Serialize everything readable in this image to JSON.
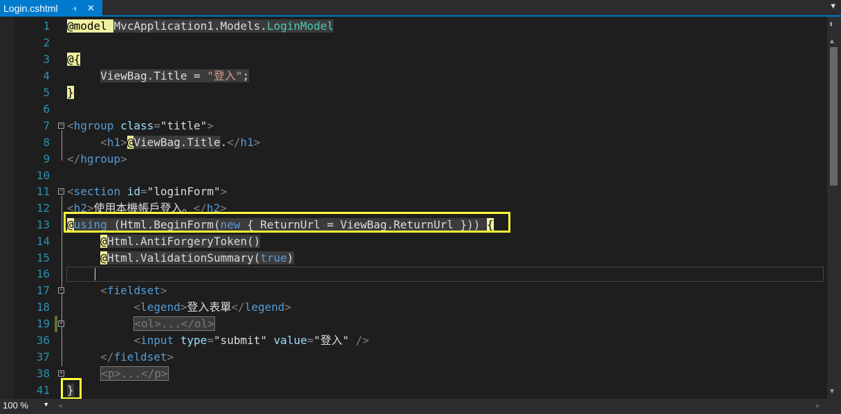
{
  "tab": {
    "title": "Login.cshtml",
    "pin_icon": "pin-icon",
    "close_icon": "close-icon"
  },
  "lines": [
    {
      "n": "1"
    },
    {
      "n": "2"
    },
    {
      "n": "3"
    },
    {
      "n": "4"
    },
    {
      "n": "5"
    },
    {
      "n": "6"
    },
    {
      "n": "7"
    },
    {
      "n": "8"
    },
    {
      "n": "9"
    },
    {
      "n": "10"
    },
    {
      "n": "11"
    },
    {
      "n": "12"
    },
    {
      "n": "13"
    },
    {
      "n": "14"
    },
    {
      "n": "15"
    },
    {
      "n": "16"
    },
    {
      "n": "17"
    },
    {
      "n": "18"
    },
    {
      "n": "19"
    },
    {
      "n": "36"
    },
    {
      "n": "37"
    },
    {
      "n": "38"
    },
    {
      "n": "41"
    }
  ],
  "code": {
    "l1": {
      "at": "@model ",
      "ns": "MvcApplication1.Models.",
      "type": "LoginModel"
    },
    "l3": "@{",
    "l4": {
      "obj": "ViewBag.Title = ",
      "str": "\"登入\"",
      "end": ";"
    },
    "l5": "}",
    "l7": {
      "open": "<",
      "el": "hgroup",
      "attr": "class",
      "eq": "=",
      "val": "\"title\"",
      "close": ">"
    },
    "l8": {
      "t1": "<",
      "el1": "h1",
      "t2": ">",
      "at": "@",
      "expr": "ViewBag.Title",
      "dot": ".",
      "t3": "</",
      "el2": "h1",
      "t4": ">"
    },
    "l9": {
      "t1": "</",
      "el": "hgroup",
      "t2": ">"
    },
    "l11": {
      "open": "<",
      "el": "section",
      "attr": "id",
      "eq": "=",
      "val": "\"loginForm\"",
      "close": ">"
    },
    "l12": {
      "t1": "<",
      "el1": "h2",
      "t2": ">",
      "text": "使用本機帳戶登入。",
      "t3": "</",
      "el2": "h2",
      "t4": ">"
    },
    "l13": {
      "at": "@",
      "kw": "using",
      "a": " (Html.BeginForm(",
      "kw2": "new",
      "b": " { ReturnUrl = ViewBag.ReturnUrl })) ",
      "brace": "{"
    },
    "l14": {
      "at": "@",
      "expr": "Html.AntiForgeryToken()"
    },
    "l15": {
      "at": "@",
      "expr": "Html.ValidationSummary(",
      "kw": "true",
      "close": ")"
    },
    "l17": {
      "t1": "<",
      "el": "fieldset",
      "t2": ">"
    },
    "l18": {
      "t1": "<",
      "el1": "legend",
      "t2": ">",
      "text": "登入表單",
      "t3": "</",
      "el2": "legend",
      "t4": ">"
    },
    "l19": "<ol>...</ol>",
    "l36": {
      "t1": "<",
      "el": "input",
      "attr1": "type",
      "val1": "\"submit\"",
      "attr2": "value",
      "val2": "\"登入\"",
      "t2": " />"
    },
    "l37": {
      "t1": "</",
      "el": "fieldset",
      "t2": ">"
    },
    "l38": "<p>...</p>",
    "l41": "}"
  },
  "status": {
    "zoom": "100 %"
  },
  "colors": {
    "background": "#1e1e1e",
    "accent": "#007acc",
    "highlight_box": "#ffff3b",
    "line_number": "#2b91af",
    "keyword": "#569cd6",
    "string": "#d69d85",
    "type": "#4ec9b0"
  }
}
